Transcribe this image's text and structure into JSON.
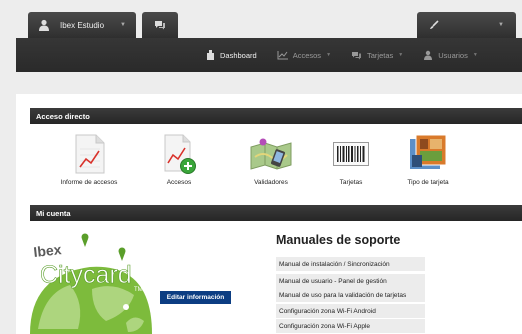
{
  "topbar": {
    "user_name": "Ibex Estudio",
    "user_caret": "▼",
    "tool_caret": "▼"
  },
  "nav": {
    "items": [
      {
        "label": "Dashboard",
        "active": true,
        "caret": ""
      },
      {
        "label": "Accesos",
        "active": false,
        "caret": "▼"
      },
      {
        "label": "Tarjetas",
        "active": false,
        "caret": "▼"
      },
      {
        "label": "Usuarios",
        "active": false,
        "caret": "▼"
      }
    ]
  },
  "acceso_directo": {
    "title": "Acceso directo",
    "items": [
      {
        "label": "Informe de accesos",
        "icon": "report-chart-icon"
      },
      {
        "label": "Accesos",
        "icon": "report-add-icon"
      },
      {
        "label": "Validadores",
        "icon": "map-phone-icon"
      },
      {
        "label": "Tarjetas",
        "icon": "barcode-icon"
      },
      {
        "label": "Tipo de tarjeta",
        "icon": "card-type-icon"
      }
    ]
  },
  "mi_cuenta": {
    "title": "Mi cuenta",
    "logo_text": {
      "brand": "Ibex",
      "product": "Citycard",
      "tm": "TM"
    },
    "edit_button": "Editar información"
  },
  "manuales": {
    "title": "Manuales de soporte",
    "items": [
      "Manual de instalación / Sincronización",
      "Manual de usuario - Panel de gestión",
      "Manual de uso para la validación de tarjetas",
      "Configuración zona Wi-Fi Android",
      "Configuración zona Wi-Fi Apple"
    ]
  },
  "colors": {
    "accent": "#0c3d82",
    "header": "#2b2b2b",
    "logo_green": "#7dbb3c"
  }
}
